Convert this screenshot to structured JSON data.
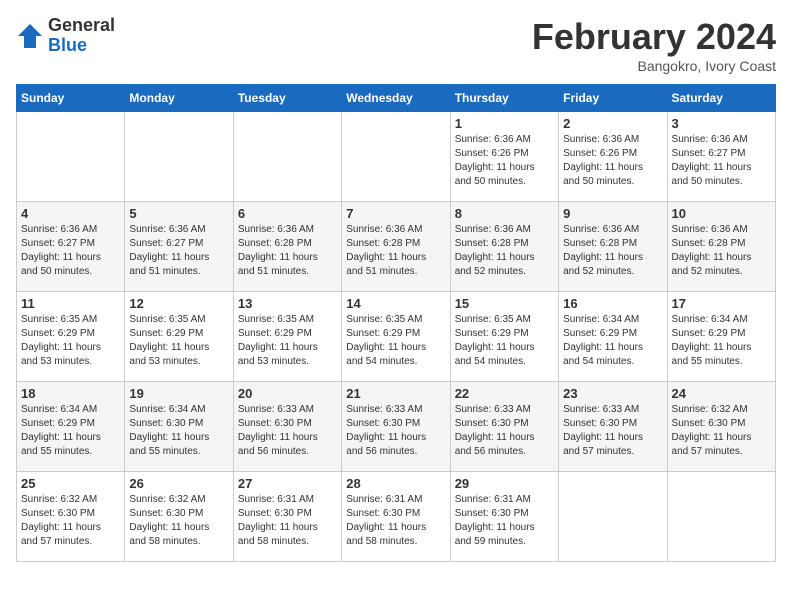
{
  "header": {
    "logo_general": "General",
    "logo_blue": "Blue",
    "month_title": "February 2024",
    "subtitle": "Bangokro, Ivory Coast"
  },
  "days_of_week": [
    "Sunday",
    "Monday",
    "Tuesday",
    "Wednesday",
    "Thursday",
    "Friday",
    "Saturday"
  ],
  "weeks": [
    [
      {
        "day": "",
        "info": ""
      },
      {
        "day": "",
        "info": ""
      },
      {
        "day": "",
        "info": ""
      },
      {
        "day": "",
        "info": ""
      },
      {
        "day": "1",
        "info": "Sunrise: 6:36 AM\nSunset: 6:26 PM\nDaylight: 11 hours\nand 50 minutes."
      },
      {
        "day": "2",
        "info": "Sunrise: 6:36 AM\nSunset: 6:26 PM\nDaylight: 11 hours\nand 50 minutes."
      },
      {
        "day": "3",
        "info": "Sunrise: 6:36 AM\nSunset: 6:27 PM\nDaylight: 11 hours\nand 50 minutes."
      }
    ],
    [
      {
        "day": "4",
        "info": "Sunrise: 6:36 AM\nSunset: 6:27 PM\nDaylight: 11 hours\nand 50 minutes."
      },
      {
        "day": "5",
        "info": "Sunrise: 6:36 AM\nSunset: 6:27 PM\nDaylight: 11 hours\nand 51 minutes."
      },
      {
        "day": "6",
        "info": "Sunrise: 6:36 AM\nSunset: 6:28 PM\nDaylight: 11 hours\nand 51 minutes."
      },
      {
        "day": "7",
        "info": "Sunrise: 6:36 AM\nSunset: 6:28 PM\nDaylight: 11 hours\nand 51 minutes."
      },
      {
        "day": "8",
        "info": "Sunrise: 6:36 AM\nSunset: 6:28 PM\nDaylight: 11 hours\nand 52 minutes."
      },
      {
        "day": "9",
        "info": "Sunrise: 6:36 AM\nSunset: 6:28 PM\nDaylight: 11 hours\nand 52 minutes."
      },
      {
        "day": "10",
        "info": "Sunrise: 6:36 AM\nSunset: 6:28 PM\nDaylight: 11 hours\nand 52 minutes."
      }
    ],
    [
      {
        "day": "11",
        "info": "Sunrise: 6:35 AM\nSunset: 6:29 PM\nDaylight: 11 hours\nand 53 minutes."
      },
      {
        "day": "12",
        "info": "Sunrise: 6:35 AM\nSunset: 6:29 PM\nDaylight: 11 hours\nand 53 minutes."
      },
      {
        "day": "13",
        "info": "Sunrise: 6:35 AM\nSunset: 6:29 PM\nDaylight: 11 hours\nand 53 minutes."
      },
      {
        "day": "14",
        "info": "Sunrise: 6:35 AM\nSunset: 6:29 PM\nDaylight: 11 hours\nand 54 minutes."
      },
      {
        "day": "15",
        "info": "Sunrise: 6:35 AM\nSunset: 6:29 PM\nDaylight: 11 hours\nand 54 minutes."
      },
      {
        "day": "16",
        "info": "Sunrise: 6:34 AM\nSunset: 6:29 PM\nDaylight: 11 hours\nand 54 minutes."
      },
      {
        "day": "17",
        "info": "Sunrise: 6:34 AM\nSunset: 6:29 PM\nDaylight: 11 hours\nand 55 minutes."
      }
    ],
    [
      {
        "day": "18",
        "info": "Sunrise: 6:34 AM\nSunset: 6:29 PM\nDaylight: 11 hours\nand 55 minutes."
      },
      {
        "day": "19",
        "info": "Sunrise: 6:34 AM\nSunset: 6:30 PM\nDaylight: 11 hours\nand 55 minutes."
      },
      {
        "day": "20",
        "info": "Sunrise: 6:33 AM\nSunset: 6:30 PM\nDaylight: 11 hours\nand 56 minutes."
      },
      {
        "day": "21",
        "info": "Sunrise: 6:33 AM\nSunset: 6:30 PM\nDaylight: 11 hours\nand 56 minutes."
      },
      {
        "day": "22",
        "info": "Sunrise: 6:33 AM\nSunset: 6:30 PM\nDaylight: 11 hours\nand 56 minutes."
      },
      {
        "day": "23",
        "info": "Sunrise: 6:33 AM\nSunset: 6:30 PM\nDaylight: 11 hours\nand 57 minutes."
      },
      {
        "day": "24",
        "info": "Sunrise: 6:32 AM\nSunset: 6:30 PM\nDaylight: 11 hours\nand 57 minutes."
      }
    ],
    [
      {
        "day": "25",
        "info": "Sunrise: 6:32 AM\nSunset: 6:30 PM\nDaylight: 11 hours\nand 57 minutes."
      },
      {
        "day": "26",
        "info": "Sunrise: 6:32 AM\nSunset: 6:30 PM\nDaylight: 11 hours\nand 58 minutes."
      },
      {
        "day": "27",
        "info": "Sunrise: 6:31 AM\nSunset: 6:30 PM\nDaylight: 11 hours\nand 58 minutes."
      },
      {
        "day": "28",
        "info": "Sunrise: 6:31 AM\nSunset: 6:30 PM\nDaylight: 11 hours\nand 58 minutes."
      },
      {
        "day": "29",
        "info": "Sunrise: 6:31 AM\nSunset: 6:30 PM\nDaylight: 11 hours\nand 59 minutes."
      },
      {
        "day": "",
        "info": ""
      },
      {
        "day": "",
        "info": ""
      }
    ]
  ]
}
